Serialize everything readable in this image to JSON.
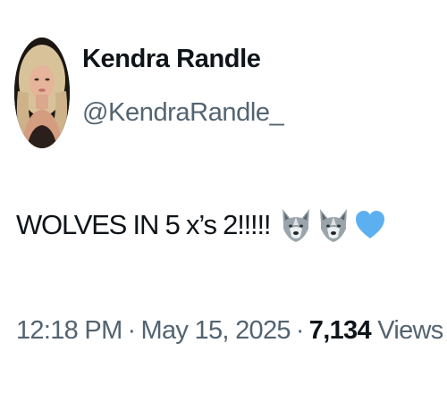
{
  "author": {
    "display_name": "Kendra Randle",
    "handle": "@KendraRandle_"
  },
  "tweet": {
    "text": "WOLVES IN 5 x’s 2!!!!!",
    "emojis": [
      "wolf-face",
      "wolf-face",
      "light-blue-heart"
    ]
  },
  "meta": {
    "time": "12:18 PM",
    "separator": "·",
    "date": "May 15, 2025",
    "views_count": "7,134",
    "views_label": "Views"
  },
  "colors": {
    "text_primary": "#0f1419",
    "text_secondary": "#536471",
    "heart": "#5db0f0"
  }
}
